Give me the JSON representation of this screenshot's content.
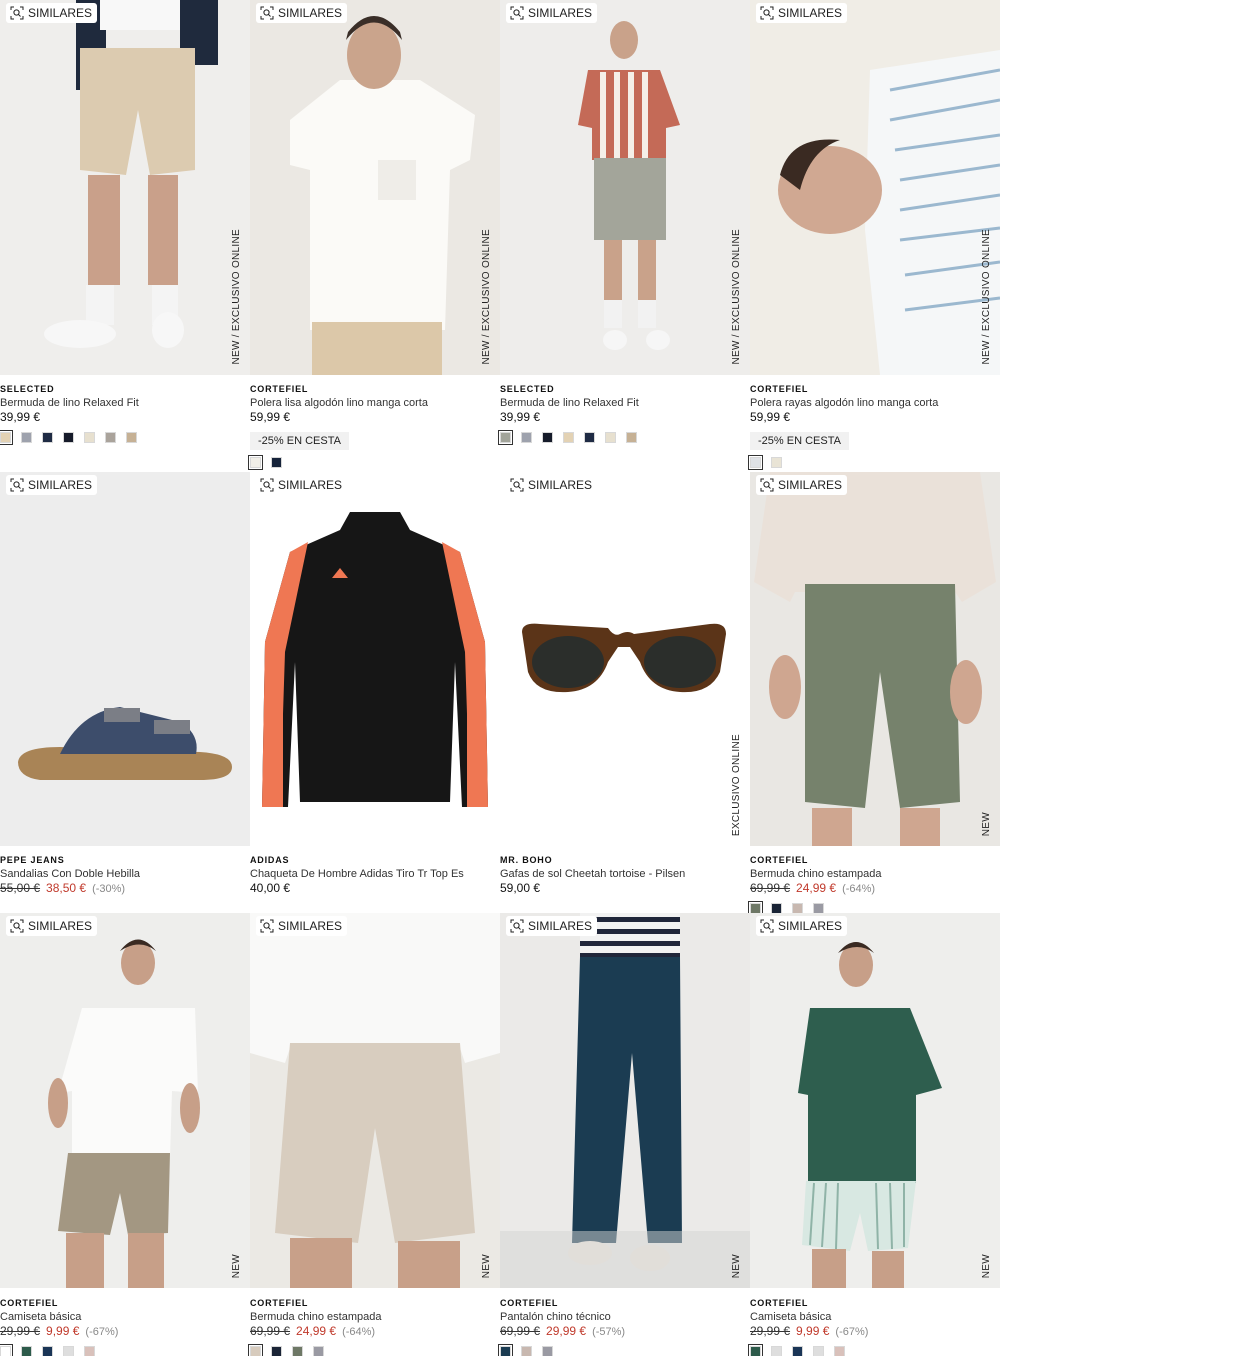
{
  "similar_label": "SIMILARES",
  "products": [
    {
      "brand": "SELECTED",
      "name": "Bermuda de lino Relaxed Fit",
      "price": "39,99 €",
      "vlabel": "NEW  /  EXCLUSIVO ONLINE",
      "swatches": [
        "#e3d2b4",
        "#9ea2ad",
        "#1f2b44",
        "#161b2a",
        "#e7e0cf",
        "#aaa39b",
        "#c6b195"
      ]
    },
    {
      "brand": "CORTEFIEL",
      "name": "Polera lisa algodón lino manga corta",
      "price": "59,99 €",
      "promo": "-25% EN CESTA",
      "vlabel": "NEW  /  EXCLUSIVO ONLINE",
      "swatches": [
        "#f1efe8",
        "#16233a"
      ]
    },
    {
      "brand": "SELECTED",
      "name": "Bermuda de lino Relaxed Fit",
      "price": "39,99 €",
      "vlabel": "NEW  /  EXCLUSIVO ONLINE",
      "swatches": [
        "#a2a49a",
        "#9ea2ad",
        "#161b2a",
        "#e3d2b4",
        "#1f2b44",
        "#e7e0cf",
        "#c6b195"
      ]
    },
    {
      "brand": "CORTEFIEL",
      "name": "Polera rayas algodón lino manga corta",
      "price": "59,99 €",
      "promo": "-25% EN CESTA",
      "vlabel": "NEW  /  EXCLUSIVO ONLINE",
      "swatches": [
        "#dfe2e6",
        "#e9e4d6"
      ]
    },
    {
      "brand": "PEPE JEANS",
      "name": "Sandalias Con Doble Hebilla",
      "old_price": "55,00 €",
      "sale_price": "38,50 €",
      "discount": "(-30%)",
      "vlabel": "",
      "swatches": []
    },
    {
      "brand": "ADIDAS",
      "name": "Chaqueta De Hombre Adidas Tiro Tr Top Es",
      "price": "40,00 €",
      "vlabel": "",
      "swatches": []
    },
    {
      "brand": "MR. BOHO",
      "name": "Gafas de sol Cheetah tortoise - Pilsen",
      "price": "59,00 €",
      "vlabel": "EXCLUSIVO ONLINE",
      "swatches": []
    },
    {
      "brand": "CORTEFIEL",
      "name": "Bermuda chino estampada",
      "old_price": "69,99 €",
      "sale_price": "24,99 €",
      "discount": "(-64%)",
      "vlabel": "NEW",
      "swatches": [
        "#6e7866",
        "#1a2436",
        "#c8b8b0",
        "#9a9aa3"
      ]
    },
    {
      "brand": "CORTEFIEL",
      "name": "Camiseta básica",
      "old_price": "29,99 €",
      "sale_price": "9,99 €",
      "discount": "(-67%)",
      "vlabel": "NEW",
      "swatches": [
        "#ffffff",
        "#2d5b4b",
        "#1a3556",
        "#dedede",
        "#d9c1bb"
      ]
    },
    {
      "brand": "CORTEFIEL",
      "name": "Bermuda chino estampada",
      "old_price": "69,99 €",
      "sale_price": "24,99 €",
      "discount": "(-64%)",
      "vlabel": "NEW",
      "swatches": [
        "#d7cbbd",
        "#1a2436",
        "#6e7866",
        "#9a9aa3"
      ]
    },
    {
      "brand": "CORTEFIEL",
      "name": "Pantalón chino técnico",
      "old_price": "69,99 €",
      "sale_price": "29,99 €",
      "discount": "(-57%)",
      "vlabel": "NEW",
      "swatches": [
        "#1b3c52",
        "#c8b8b0",
        "#9a9aa3"
      ]
    },
    {
      "brand": "CORTEFIEL",
      "name": "Camiseta básica",
      "old_price": "29,99 €",
      "sale_price": "9,99 €",
      "discount": "(-67%)",
      "vlabel": "NEW",
      "swatches": [
        "#2d5b4b",
        "#dedede",
        "#1a3556",
        "#dedede",
        "#d9c1bb"
      ]
    }
  ]
}
